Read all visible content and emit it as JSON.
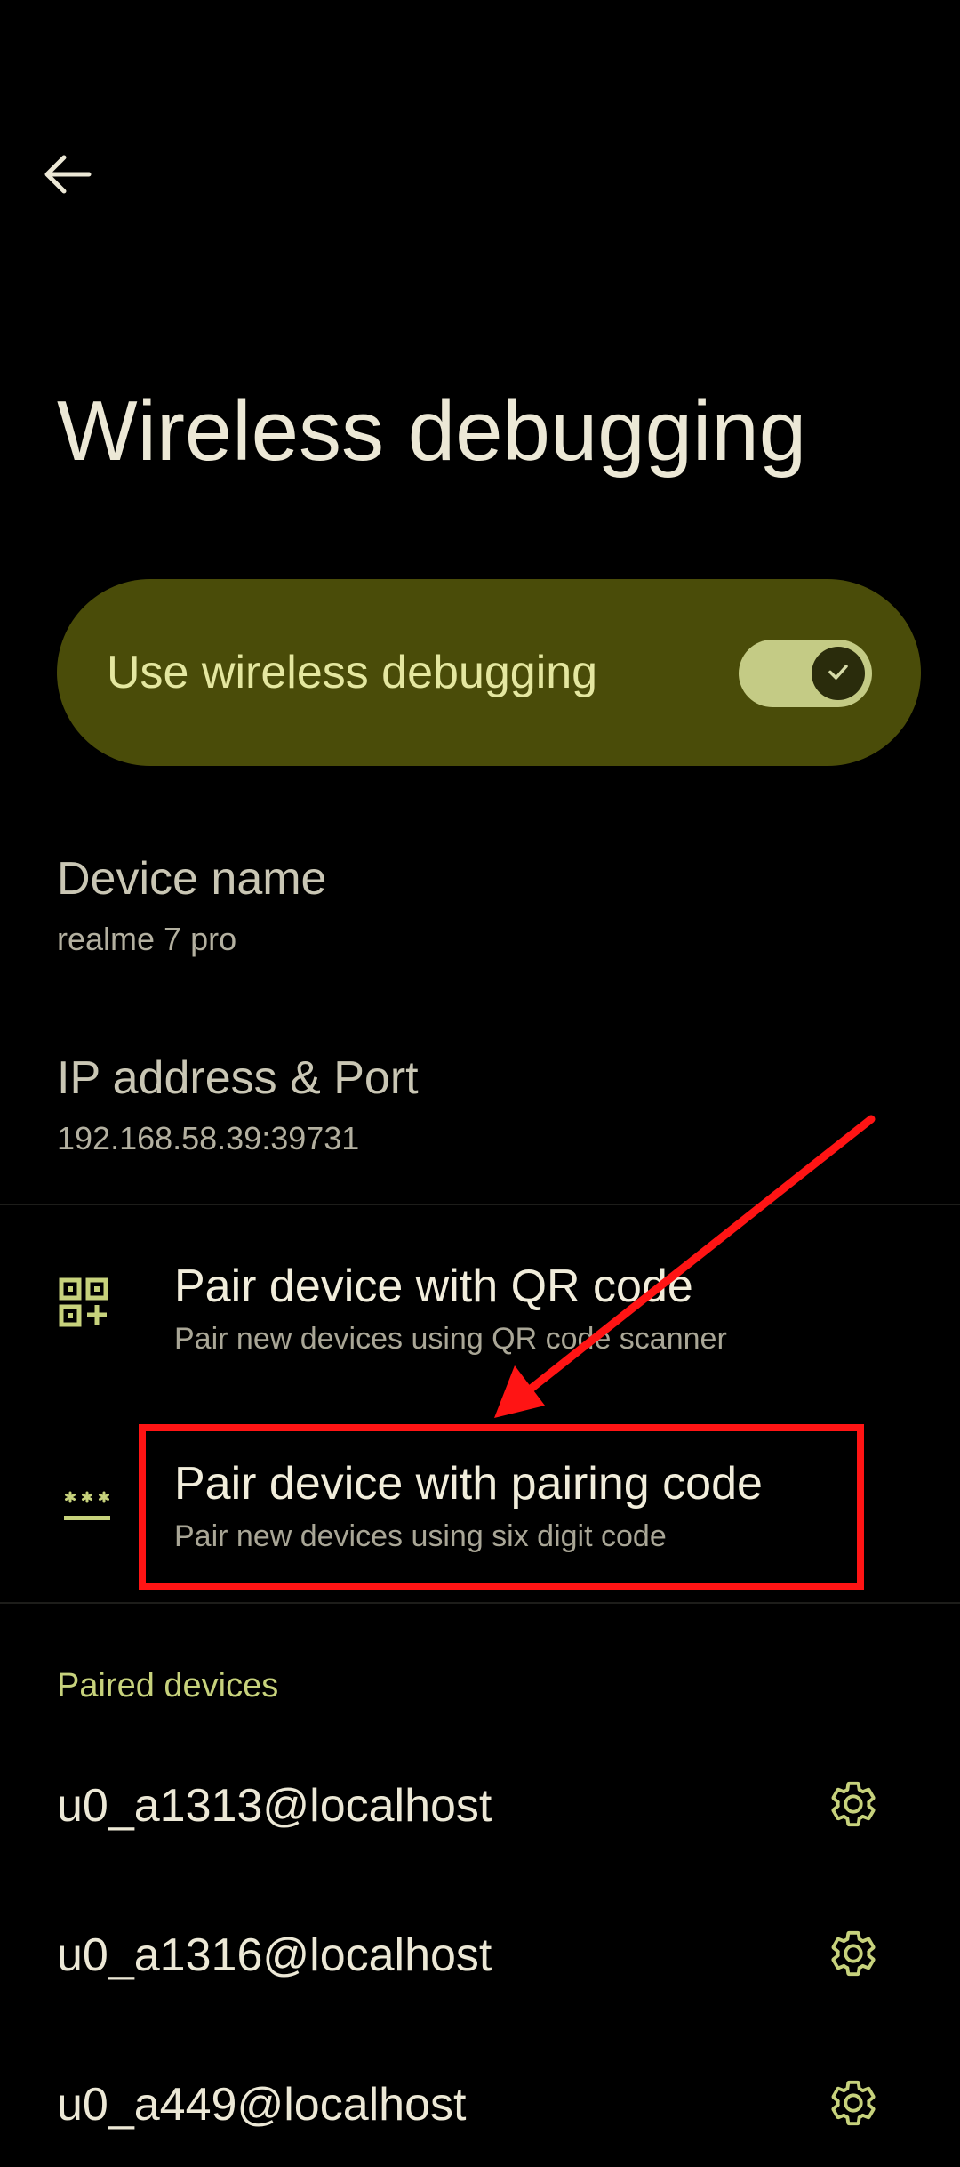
{
  "header": {
    "back_icon": "arrow-left-icon",
    "title": "Wireless debugging"
  },
  "main_toggle": {
    "label": "Use wireless debugging",
    "checked": true,
    "check_icon": "check-icon"
  },
  "device_name": {
    "title": "Device name",
    "value": "realme 7 pro"
  },
  "ip_address": {
    "title": "IP address & Port",
    "value": "192.168.58.39:39731"
  },
  "pair_qr": {
    "icon": "qr-code-icon",
    "title": "Pair device with QR code",
    "summary": "Pair new devices using QR code scanner"
  },
  "pair_code": {
    "icon": "password-icon",
    "title": "Pair device with pairing code",
    "summary": "Pair new devices using six digit code"
  },
  "paired_devices": {
    "header": "Paired devices",
    "items": [
      {
        "name": "u0_a1313@localhost",
        "icon": "gear-icon"
      },
      {
        "name": "u0_a1316@localhost",
        "icon": "gear-icon"
      },
      {
        "name": "u0_a449@localhost",
        "icon": "gear-icon"
      }
    ]
  },
  "colors": {
    "background": "#000000",
    "accent": "#c7d27c",
    "toggle_card": "#4a4c09",
    "annotation": "#ff1414"
  }
}
